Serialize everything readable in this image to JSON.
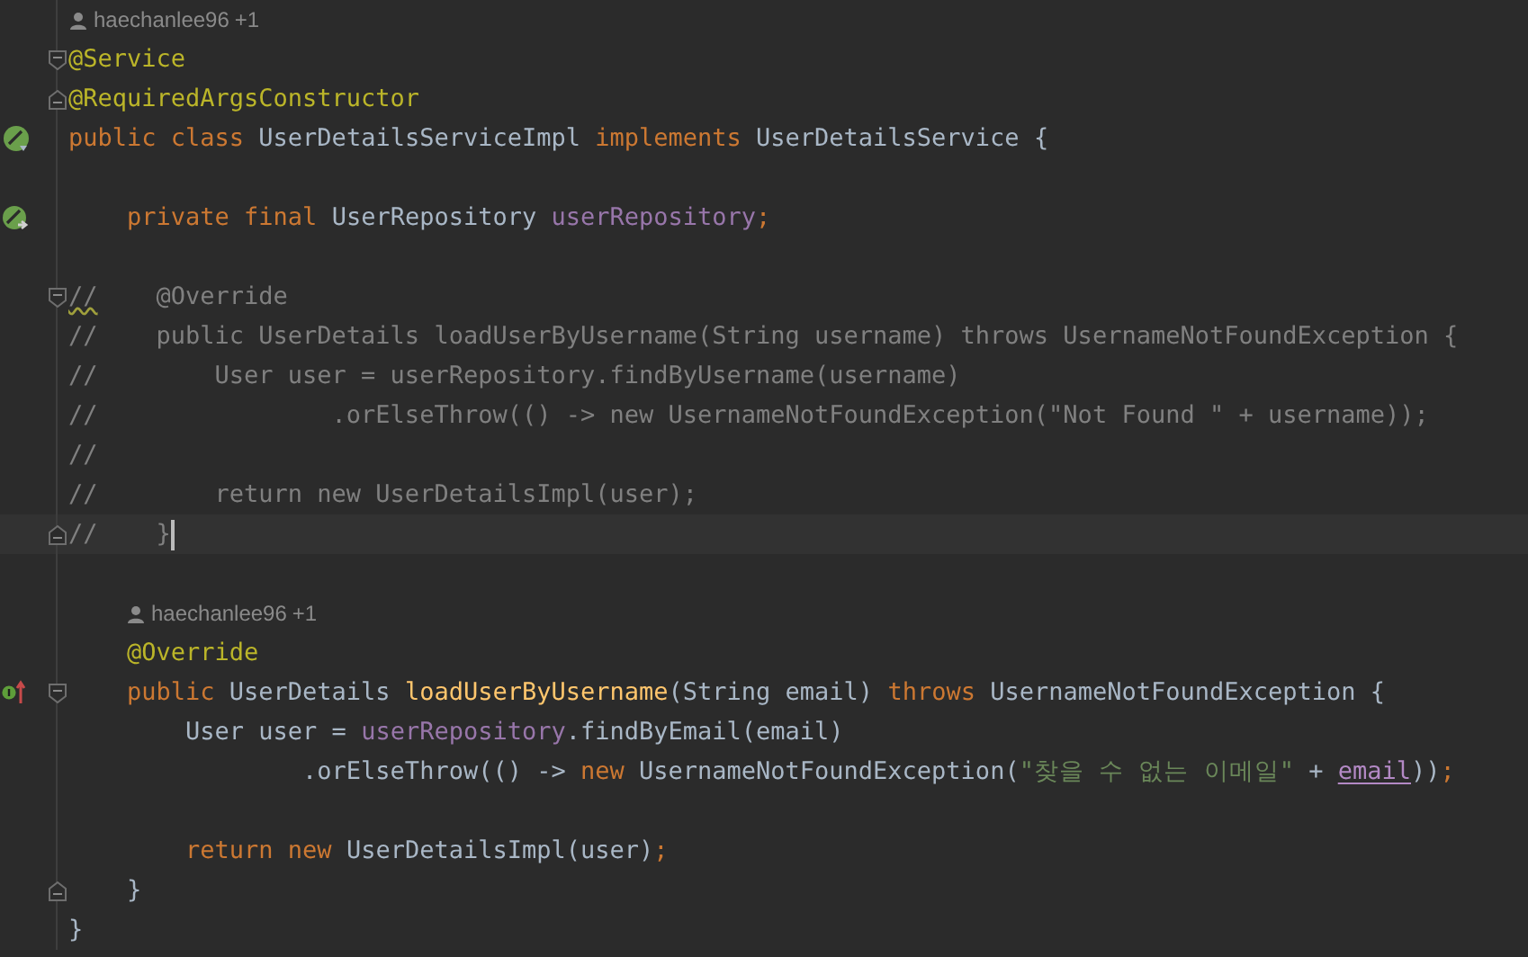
{
  "lines": [
    {
      "kind": "hint",
      "indented": false,
      "author": "haechanlee96",
      "extra": "+1"
    },
    {
      "kind": "code",
      "current": false,
      "fold": {
        "kind": "start"
      },
      "tokens": [
        {
          "t": "@Service",
          "kind": "annotation"
        }
      ]
    },
    {
      "kind": "code",
      "current": false,
      "fold": {
        "kind": "end"
      },
      "tokens": [
        {
          "t": "@RequiredArgsConstructor",
          "kind": "annotation"
        }
      ]
    },
    {
      "kind": "code",
      "current": false,
      "gutter_icon": {
        "kind": "bean"
      },
      "tokens": [
        {
          "t": "public class ",
          "kind": "keyword"
        },
        {
          "t": "UserDetailsServiceImpl ",
          "kind": "plain"
        },
        {
          "t": "implements ",
          "kind": "keyword"
        },
        {
          "t": "UserDetailsService {",
          "kind": "plain"
        }
      ]
    },
    {
      "kind": "blank"
    },
    {
      "kind": "code",
      "current": false,
      "gutter_icon": {
        "kind": "bean_injected"
      },
      "tokens": [
        {
          "t": "    private final ",
          "kind": "keyword"
        },
        {
          "t": "UserRepository ",
          "kind": "plain"
        },
        {
          "t": "userRepository",
          "kind": "field"
        },
        {
          "t": ";",
          "kind": "keyword"
        }
      ]
    },
    {
      "kind": "blank"
    },
    {
      "kind": "code",
      "current": false,
      "fold": {
        "kind": "start"
      },
      "tokens": [
        {
          "t": "//",
          "kind": "comment",
          "warning": true
        },
        {
          "t": "    @Override",
          "kind": "comment",
          "warning": false
        }
      ]
    },
    {
      "kind": "code",
      "current": false,
      "tokens": [
        {
          "t": "//    public UserDetails loadUserByUsername(String username) throws UsernameNotFoundException {",
          "kind": "comment"
        }
      ]
    },
    {
      "kind": "code",
      "current": false,
      "tokens": [
        {
          "t": "//        User user = userRepository.findByUsername(username)",
          "kind": "comment"
        }
      ]
    },
    {
      "kind": "code",
      "current": false,
      "tokens": [
        {
          "t": "//                .orElseThrow(() -> new UsernameNotFoundException(\"Not Found \" + username));",
          "kind": "comment"
        }
      ]
    },
    {
      "kind": "code",
      "current": false,
      "tokens": [
        {
          "t": "//",
          "kind": "comment"
        }
      ]
    },
    {
      "kind": "code",
      "current": false,
      "tokens": [
        {
          "t": "//        return new UserDetailsImpl(user);",
          "kind": "comment"
        }
      ]
    },
    {
      "kind": "code",
      "current": true,
      "fold": {
        "kind": "end"
      },
      "tokens": [
        {
          "t": "//    }",
          "kind": "comment"
        }
      ]
    },
    {
      "kind": "blank"
    },
    {
      "kind": "hint",
      "indented": true,
      "author": "haechanlee96",
      "extra": "+1"
    },
    {
      "kind": "code",
      "current": false,
      "tokens": [
        {
          "t": "    @Override",
          "kind": "annotation"
        }
      ]
    },
    {
      "kind": "code",
      "current": false,
      "fold": {
        "kind": "start"
      },
      "gutter_icon": {
        "kind": "implements"
      },
      "tokens": [
        {
          "t": "    public ",
          "kind": "keyword"
        },
        {
          "t": "UserDetails ",
          "kind": "plain"
        },
        {
          "t": "loadUserByUsername",
          "kind": "method"
        },
        {
          "t": "(String email) ",
          "kind": "plain"
        },
        {
          "t": "throws ",
          "kind": "keyword"
        },
        {
          "t": "UsernameNotFoundException {",
          "kind": "plain"
        }
      ]
    },
    {
      "kind": "code",
      "current": false,
      "tokens": [
        {
          "t": "        User user = ",
          "kind": "plain"
        },
        {
          "t": "userRepository",
          "kind": "field"
        },
        {
          "t": ".findByEmail(email)",
          "kind": "plain"
        }
      ]
    },
    {
      "kind": "code",
      "current": false,
      "tokens": [
        {
          "t": "                .orElseThrow(() -> ",
          "kind": "plain"
        },
        {
          "t": "new ",
          "kind": "keyword"
        },
        {
          "t": "UsernameNotFoundException(",
          "kind": "plain"
        },
        {
          "t": "\"찾을 수 없는 이메일\"",
          "kind": "string"
        },
        {
          "t": " + ",
          "kind": "plain"
        },
        {
          "t": "email",
          "kind": "captured"
        },
        {
          "t": "))",
          "kind": "plain"
        },
        {
          "t": ";",
          "kind": "keyword"
        }
      ]
    },
    {
      "kind": "blank"
    },
    {
      "kind": "code",
      "current": false,
      "tokens": [
        {
          "t": "        return new ",
          "kind": "keyword"
        },
        {
          "t": "UserDetailsImpl(user)",
          "kind": "plain"
        },
        {
          "t": ";",
          "kind": "keyword"
        }
      ]
    },
    {
      "kind": "code",
      "current": false,
      "fold": {
        "kind": "end"
      },
      "tokens": [
        {
          "t": "    }",
          "kind": "plain"
        }
      ]
    },
    {
      "kind": "code",
      "current": false,
      "tokens": [
        {
          "t": "}",
          "kind": "plain"
        }
      ]
    }
  ]
}
